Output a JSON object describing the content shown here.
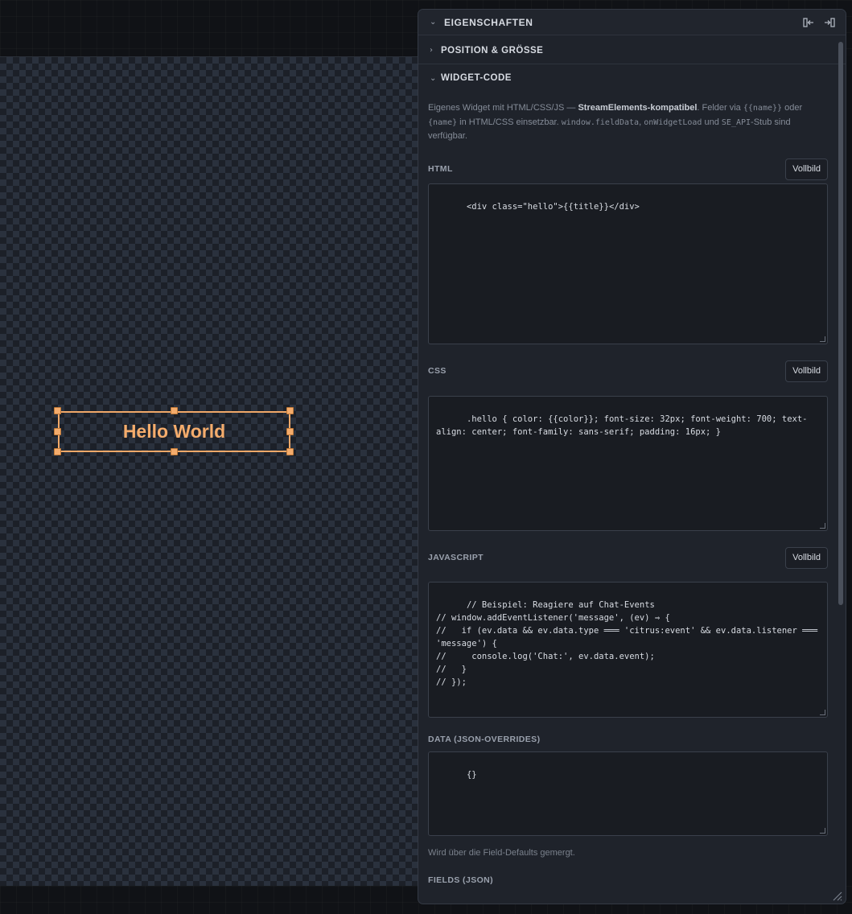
{
  "canvas": {
    "widget_text": "Hello World"
  },
  "panel": {
    "title": "EIGENSCHAFTEN",
    "icons": [
      "dock-left-icon",
      "dock-right-icon"
    ],
    "sections": {
      "position": "POSITION & GRÖSSE",
      "widget_code": "WIDGET-CODE"
    },
    "description": {
      "part1": "Eigenes Widget mit HTML/CSS/JS — ",
      "bold": "StreamElements-kompatibel",
      "part2": ". Felder via ",
      "code1": "{{name}}",
      "part3": " oder ",
      "code2": "{name}",
      "part4": " in HTML/CSS einsetzbar. ",
      "code3": "window.fieldData",
      "part5": ", ",
      "code4": "onWidgetLoad",
      "part6": " und ",
      "code5": "SE_API",
      "part7": "-Stub sind verfügbar."
    },
    "html": {
      "label": "HTML",
      "button": "Vollbild",
      "value": "<div class=\"hello\">{{title}}</div>"
    },
    "css": {
      "label": "CSS",
      "button": "Vollbild",
      "value": ".hello { color: {{color}}; font-size: 32px; font-weight: 700; text-align: center; font-family: sans-serif; padding: 16px; }"
    },
    "javascript": {
      "label": "JAVASCRIPT",
      "button": "Vollbild",
      "value": "// Beispiel: Reagiere auf Chat-Events\n// window.addEventListener('message', (ev) ⇒ {\n//   if (ev.data && ev.data.type ═══ 'citrus:event' && ev.data.listener ═══ 'message') {\n//     console.log('Chat:', ev.data.event);\n//   }\n// });"
    },
    "data": {
      "label": "DATA (JSON-OVERRIDES)",
      "value": "{}",
      "hint": "Wird über die Field-Defaults gemergt."
    },
    "fields": {
      "label": "FIELDS (JSON)"
    }
  },
  "colors": {
    "accent": "#f4ac6c",
    "panel_bg": "#1f232b",
    "canvas_checker": "#2a313d"
  }
}
